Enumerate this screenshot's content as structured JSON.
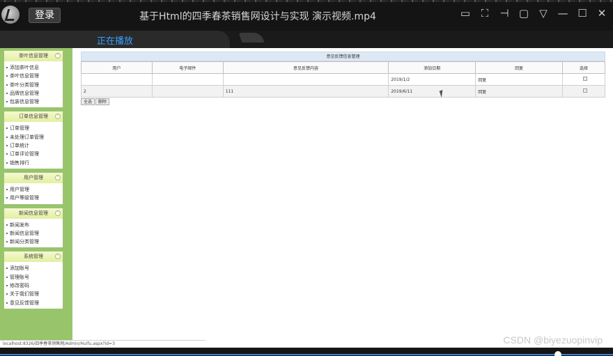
{
  "player": {
    "login_label": "登录",
    "title": "基于Html的四季春茶销售网设计与实现 演示视频.mp4",
    "tab_active": "正在播放",
    "watermark": "CSDN @biyezuopinvip",
    "progress_fraction": 0.91,
    "icons": [
      "snapshot-icon",
      "fullscreen-icon",
      "pin-icon",
      "folder-icon",
      "dropdown-icon",
      "minimize-icon",
      "maximize-icon",
      "close-icon"
    ]
  },
  "sidebar": {
    "groups": [
      {
        "title": "茶叶信息管理",
        "items": [
          "添加茶叶信息",
          "茶叶信息管理",
          "茶叶分类管理",
          "品牌信息管理",
          "包装信息管理"
        ]
      },
      {
        "title": "订单信息管理",
        "items": [
          "订单管理",
          "未处理订单管理",
          "订单统计",
          "订单评论管理",
          "销售排行"
        ]
      },
      {
        "title": "用户管理",
        "items": [
          "用户管理",
          "用户等级管理"
        ]
      },
      {
        "title": "新闻信息管理",
        "items": [
          "新闻发布",
          "新闻信息管理",
          "新闻分类管理"
        ]
      },
      {
        "title": "系统管理",
        "items": [
          "添加账号",
          "管理账号",
          "修改密码",
          "关于我们管理",
          "意见反馈管理"
        ]
      }
    ]
  },
  "content": {
    "table_title": "意见反馈信息管理",
    "columns": [
      "用户",
      "电子邮件",
      "意见反馈内容",
      "添加日期",
      "回复",
      "选择"
    ],
    "rows": [
      {
        "user": "",
        "email": "",
        "feedback": "",
        "date": "2019/1/2",
        "reply": "回复"
      },
      {
        "user": "2",
        "email": "",
        "feedback": "111",
        "date": "2019/6/11",
        "reply": "回复"
      }
    ],
    "select_all_label": "全选",
    "delete_label": "删除"
  },
  "status_url": "localhost:8326/四季春茶销售网/Admin/Huifu.aspx?id=3"
}
